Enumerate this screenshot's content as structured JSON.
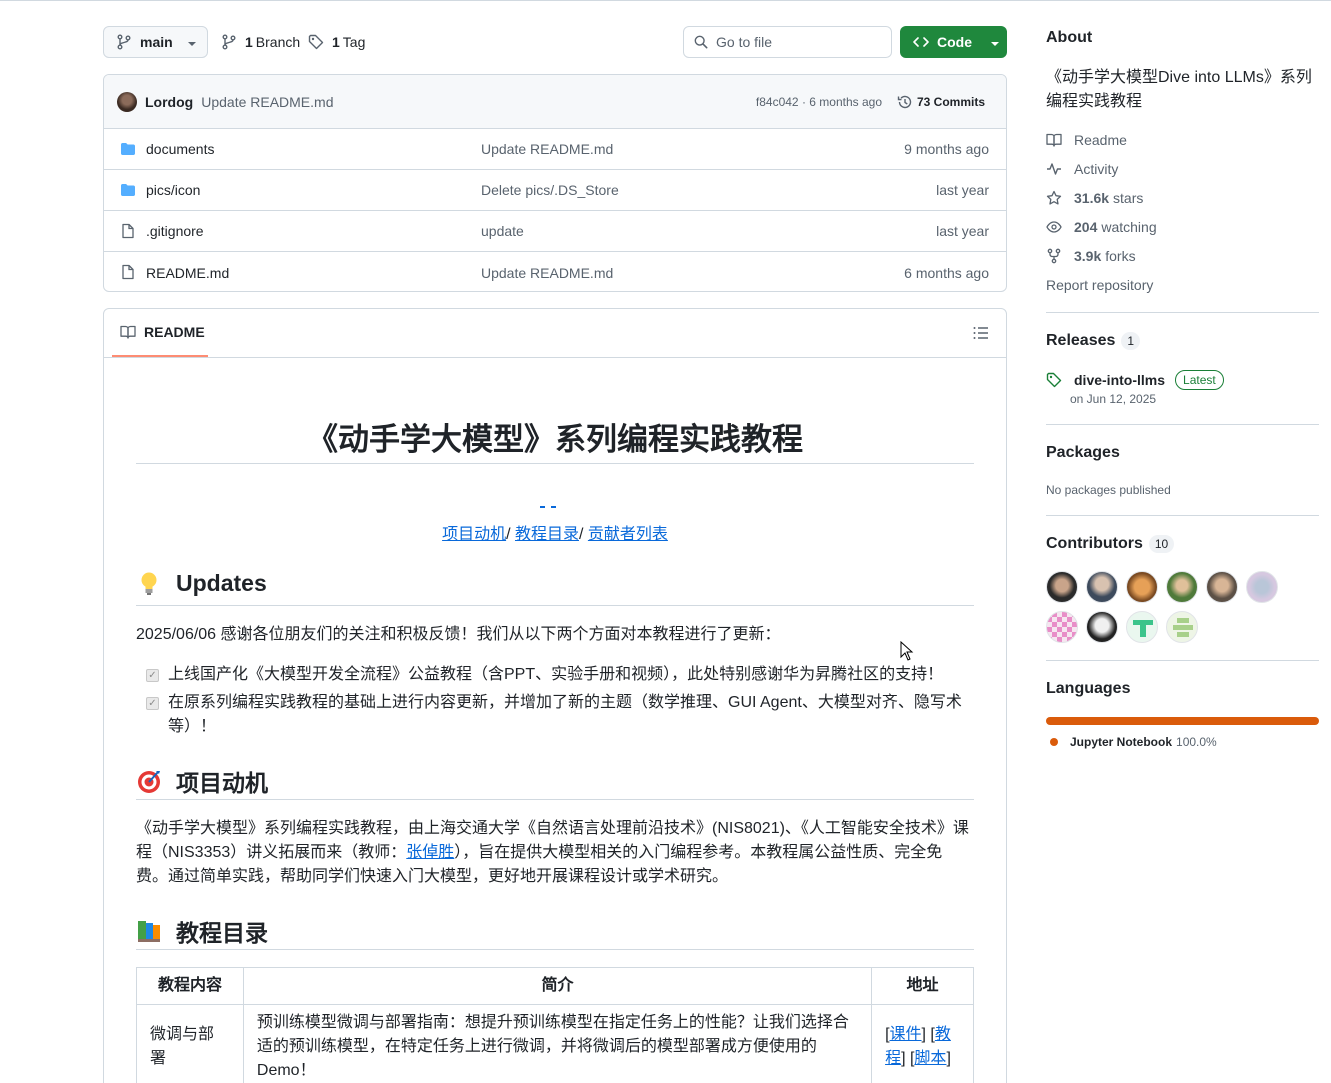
{
  "toolbar": {
    "branch": "main",
    "branch_count": "1",
    "branch_label": "Branch",
    "tag_count": "1",
    "tag_label": "Tag",
    "search_placeholder": "Go to file",
    "code_label": "Code"
  },
  "latest_commit": {
    "author": "Lordog",
    "message": "Update README.md",
    "hash_time": "f84c042 · 6 months ago",
    "commits": "73 Commits"
  },
  "files": [
    {
      "type": "folder",
      "name": "documents",
      "message": "Update README.md",
      "time": "9 months ago"
    },
    {
      "type": "folder",
      "name": "pics/icon",
      "message": "Delete pics/.DS_Store",
      "time": "last year"
    },
    {
      "type": "file",
      "name": ".gitignore",
      "message": "update",
      "time": "last year"
    },
    {
      "type": "file",
      "name": "README.md",
      "message": "Update README.md",
      "time": "6 months ago"
    }
  ],
  "readme": {
    "tab_label": "README",
    "title": "《动手学大模型》系列编程实践教程",
    "nav": {
      "link1": "项目动机",
      "sep1": "/ ",
      "link2": "教程目录",
      "sep2": "/ ",
      "link3": "贡献者列表"
    },
    "updates_heading": "Updates",
    "updates_intro": "2025/06/06 感谢各位朋友们的关注和积极反馈！我们从以下两个方面对本教程进行了更新：",
    "tasks": [
      "上线国产化《大模型开发全流程》公益教程（含PPT、实验手册和视频），此处特别感谢华为昇腾社区的支持！",
      "在原系列编程实践教程的基础上进行内容更新，并增加了新的主题（数学推理、GUI Agent、大模型对齐、隐写术等）！"
    ],
    "motivation_heading": "项目动机",
    "motivation_pre": "《动手学大模型》系列编程实践教程，由上海交通大学《自然语言处理前沿技术》(NIS8021)、《人工智能安全技术》课程（NIS3353）讲义拓展而来（教师：",
    "motivation_link": "张倬胜",
    "motivation_post": "），旨在提供大模型相关的入门编程参考。本教程属公益性质、完全免费。通过简单实践，帮助同学们快速入门大模型，更好地开展课程设计或学术研究。",
    "catalog_heading": "教程目录",
    "table": {
      "headers": [
        "教程内容",
        "简介",
        "地址"
      ],
      "row1": {
        "name": "微调与部署",
        "desc": "预训练模型微调与部署指南：想提升预训练模型在指定任务上的性能？让我们选择合适的预训练模型，在特定任务上进行微调，并将微调后的模型部署成方便使用的Demo！",
        "links": [
          "课件",
          "教程",
          "脚本"
        ]
      }
    }
  },
  "sidebar": {
    "about_heading": "About",
    "about_desc": "《动手学大模型Dive into LLMs》系列编程实践教程",
    "readme": "Readme",
    "activity": "Activity",
    "stars_count": "31.6k",
    "stars_label": "stars",
    "watching_count": "204",
    "watching_label": "watching",
    "forks_count": "3.9k",
    "forks_label": "forks",
    "report": "Report repository",
    "releases_heading": "Releases",
    "releases_count": "1",
    "release_name": "dive-into-llms",
    "release_badge": "Latest",
    "release_date": "on Jun 12, 2025",
    "packages_heading": "Packages",
    "packages_text": "No packages published",
    "contributors_heading": "Contributors",
    "contributors_count": "10",
    "languages_heading": "Languages",
    "language_name": "Jupyter Notebook",
    "language_pct": "100.0%",
    "language_color": "#DA5B0B"
  }
}
